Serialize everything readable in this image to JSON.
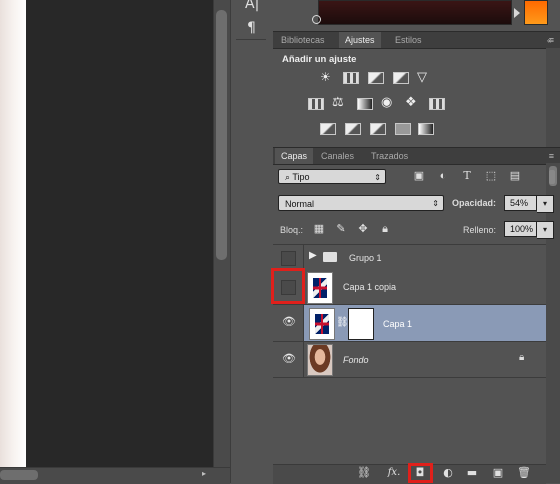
{
  "colors": {
    "accent_selection": "#8a9ab6",
    "highlight_red": "#e0201b"
  },
  "tools": {
    "text_tool_icon": "character-panel-icon",
    "paragraph_glyph": "¶",
    "text_glyph": "A|"
  },
  "top_tabs": [
    "Bibliotecas",
    "Ajustes",
    "Estilos"
  ],
  "top_tabs_active": "Ajustes",
  "adjustments": {
    "title": "Añadir un ajuste"
  },
  "layers_tabs": [
    "Capas",
    "Canales",
    "Trazados"
  ],
  "layers_tabs_active": "Capas",
  "layers": {
    "filter_label": "Tipo",
    "blend_mode": "Normal",
    "opacity_label": "Opacidad:",
    "opacity_value": "54%",
    "lock_label": "Bloq.:",
    "fill_label": "Relleno:",
    "fill_value": "100%",
    "items": [
      {
        "name": "Grupo 1",
        "type": "group",
        "visible": false
      },
      {
        "name": "Capa 1 copia",
        "type": "layer",
        "visible": false
      },
      {
        "name": "Capa 1",
        "type": "layer-with-mask",
        "visible": true,
        "selected": true
      },
      {
        "name": "Fondo",
        "type": "background",
        "visible": true,
        "locked": true
      }
    ]
  },
  "bottom_bar": {
    "fx_label": "fx."
  }
}
